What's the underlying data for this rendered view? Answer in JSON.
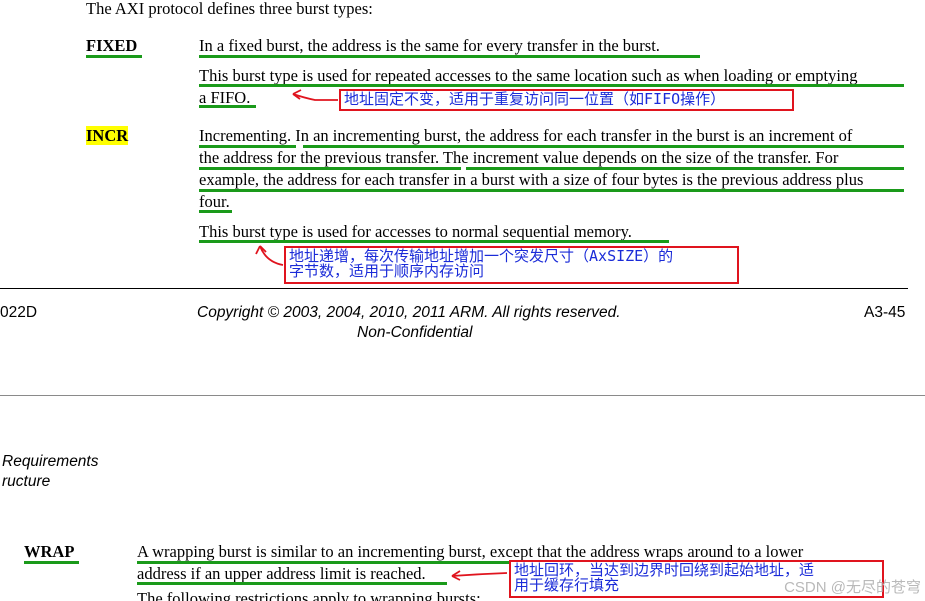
{
  "intro": "The AXI protocol defines three burst types:",
  "fixed": {
    "term": "FIXED",
    "line1": "In a fixed burst, the address is the same for every transfer in the burst.",
    "para2_line1": "This burst type is used for repeated accesses to the same location such as when loading or emptying",
    "para2_line2": "a FIFO.",
    "note": "地址固定不变，适用于重复访问同一位置（如FIFO操作）"
  },
  "incr": {
    "term": "INCR",
    "l1": "Incrementing. In an incrementing burst, the address for each transfer in the burst is an increment of",
    "l2": "the address for the previous transfer. The increment value depends on the size of the transfer. For",
    "l3": "example, the address for each transfer in a burst with a size of four bytes is the previous address plus",
    "l4": "four.",
    "para2": "This burst type is used for accesses to normal sequential memory.",
    "note_l1": "地址递增，每次传输地址增加一个突发尺寸（AxSIZE）的",
    "note_l2": "字节数，适用于顺序内存访问"
  },
  "footer": {
    "doc_id": "022D",
    "copyright": "Copyright © 2003, 2004, 2010, 2011 ARM. All rights reserved.",
    "confidentiality": "Non-Confidential",
    "page": "A3-45"
  },
  "next_page": {
    "header_l1": "Requirements",
    "header_l2": "ructure"
  },
  "wrap": {
    "term": "WRAP",
    "l1": "A wrapping burst is similar to an incrementing burst, except that the address wraps around to a lower",
    "l2": "address if an upper address limit is reached.",
    "l3": "The following restrictions apply to wrapping bursts:",
    "note_l1": "地址回环，当达到边界时回绕到起始地址，适",
    "note_l2": "用于缓存行填充"
  },
  "watermark": "CSDN @无尽的苍穹",
  "colors": {
    "underline": "#1a9a1a",
    "annotation_border": "#e0141e",
    "annotation_text": "#1a2bd8",
    "highlight": "#ffff00"
  }
}
